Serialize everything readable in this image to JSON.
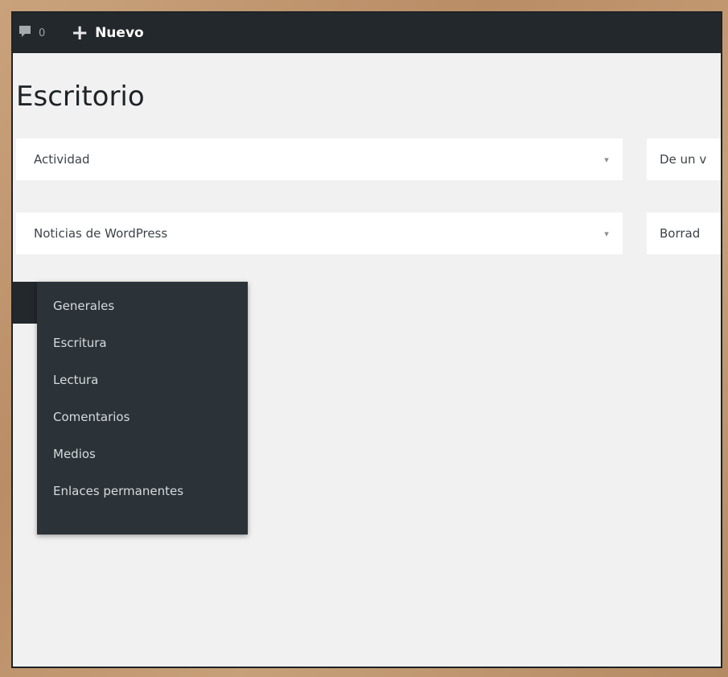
{
  "admin_bar": {
    "comments_count": "0",
    "new_label": "Nuevo"
  },
  "page": {
    "title": "Escritorio"
  },
  "panels": [
    {
      "label": "Actividad",
      "toggle": "▾"
    },
    {
      "label": "De un v"
    },
    {
      "label": "Noticias de WordPress",
      "toggle": "▾"
    },
    {
      "label": "Borrad"
    }
  ],
  "settings_submenu": {
    "items": [
      {
        "label": "Generales"
      },
      {
        "label": "Escritura"
      },
      {
        "label": "Lectura"
      },
      {
        "label": "Comentarios"
      },
      {
        "label": "Medios"
      },
      {
        "label": "Enlaces permanentes"
      }
    ]
  }
}
